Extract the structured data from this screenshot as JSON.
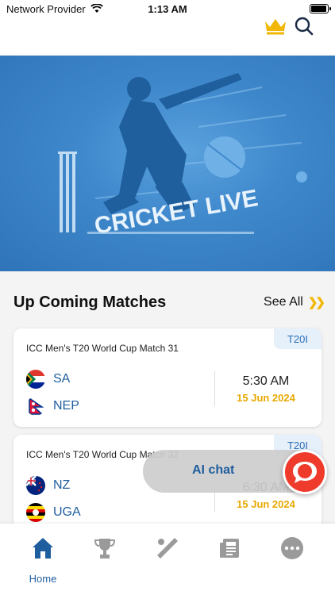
{
  "status_bar": {
    "carrier": "Network Provider",
    "time": "1:13 AM"
  },
  "header": {
    "crown_icon": "crown-icon",
    "search_icon": "search-icon",
    "accent": "#f2b705"
  },
  "banner": {
    "title": "CRICKET LIVE",
    "bg_color": "#3f88cc"
  },
  "upcoming": {
    "title": "Up Coming Matches",
    "see_all_label": "See All",
    "see_all_icon": "double-chevron-right-icon",
    "matches": [
      {
        "format": "T20I",
        "title": "ICC Men's T20 World Cup Match 31",
        "team1": "SA",
        "team2": "NEP",
        "time": "5:30 AM",
        "date": "15 Jun 2024"
      },
      {
        "format": "T20I",
        "title": "ICC Men's T20 World Cup Match 32",
        "team1": "NZ",
        "team2": "UGA",
        "time": "6:30 AM",
        "date": "15 Jun 2024"
      }
    ]
  },
  "ai_chat": {
    "label": "AI chat",
    "icon": "chat-bubble-icon",
    "color": "#ef3b2c"
  },
  "bottom_nav": {
    "items": [
      {
        "label": "Home",
        "icon": "home-icon",
        "active": true
      },
      {
        "icon": "trophy-icon"
      },
      {
        "icon": "cricket-bat-icon"
      },
      {
        "icon": "news-icon"
      },
      {
        "icon": "more-icon"
      }
    ],
    "active_color": "#1f5e9e"
  }
}
